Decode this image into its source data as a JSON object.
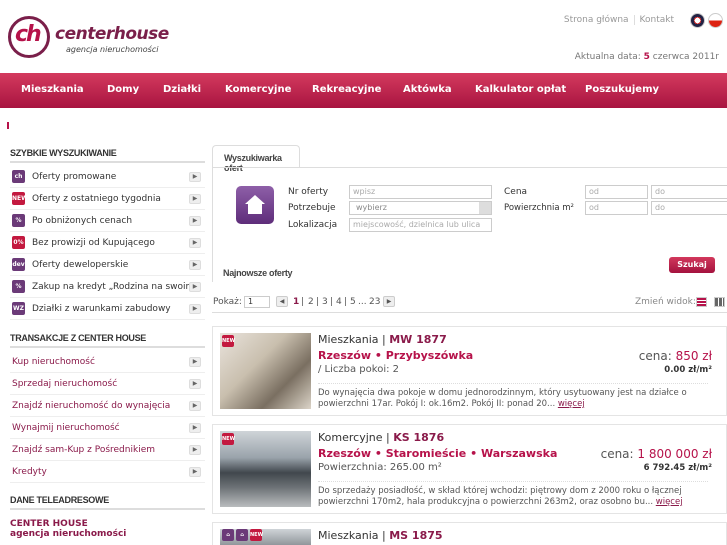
{
  "header": {
    "logo_name": "centerhouse",
    "logo_sub": "agencja nieruchomości",
    "logo_mark": "ch",
    "links": [
      "Strona główna",
      "Kontakt"
    ],
    "date_label": "Aktualna data:",
    "date_day": "5",
    "date_rest": "czerwca 2011r"
  },
  "nav": {
    "items": [
      "Mieszkania",
      "Domy",
      "Działki",
      "Komercyjne",
      "Rekreacyjne",
      "Aktówka",
      "Kalkulator opłat",
      "Poszukujemy"
    ]
  },
  "sidebar": {
    "quick_title": "SZYBKIE WYSZUKIWANIE",
    "quick_items": [
      {
        "label": "Oferty promowane",
        "icon": "ch"
      },
      {
        "label": "Oferty z ostatniego tygodnia",
        "icon": "NEW"
      },
      {
        "label": "Po obniżonych cenach",
        "icon": "%"
      },
      {
        "label": "Bez prowizji od Kupującego",
        "icon": "0%"
      },
      {
        "label": "Oferty deweloperskie",
        "icon": "dev"
      },
      {
        "label": "Zakup na kredyt „Rodzina na swoim”",
        "icon": "%"
      },
      {
        "label": "Działki z warunkami zabudowy",
        "icon": "WZ"
      }
    ],
    "trans_title": "TRANSAKCJE Z CENTER HOUSE",
    "trans_items": [
      "Kup nieruchomość",
      "Sprzedaj nieruchomość",
      "Znajdź nieruchomość do wynajęcia",
      "Wynajmij nieruchomość",
      "Znajdź sam-Kup z Pośrednikiem",
      "Kredyty"
    ],
    "contact_title": "DANE TELEADRESOWE",
    "contact_name": "CENTER HOUSE",
    "contact_sub": "agencja nieruchomości"
  },
  "search": {
    "tab": "Wyszukiwarka ofert",
    "nr_label": "Nr oferty",
    "nr_placeholder": "wpisz",
    "need_label": "Potrzebuje",
    "need_value": "wybierz",
    "loc_label": "Lokalizacja",
    "loc_placeholder": "miejscowość, dzielnica lub ulica",
    "price_label": "Cena",
    "area_label": "Powierzchnia m²",
    "from": "od",
    "to": "do",
    "button": "Szukaj ofert",
    "newest_title": "Najnowsze oferty"
  },
  "pager": {
    "label": "Pokaż:",
    "per_page": "1",
    "pages": [
      "1",
      "|",
      "2",
      "|",
      "3",
      "|",
      "4",
      "|",
      "5",
      "...",
      "23"
    ],
    "view_label": "Zmień widok:"
  },
  "listings": [
    {
      "category": "Mieszkania | ",
      "code": "MW 1877",
      "location": "Rzeszów • Przybyszówka",
      "extra": "/ Liczba pokoi: 2",
      "price_label": "cena: ",
      "price": "850 zł",
      "per_m2": "0.00 zł/m²",
      "desc": "Do wynajęcia dwa pokoje w domu jednorodzinnym, który usytuowany jest na działce o powierzchni 17ar. Pokój I: ok.16m2. Pokój II: ponad 20... ",
      "more": "więcej"
    },
    {
      "category": "Komercyjne | ",
      "code": "KS 1876",
      "location": "Rzeszów • Staromieście • Warszawska",
      "extra": "Powierzchnia: 265.00 m²",
      "price_label": "cena: ",
      "price": "1 800 000 zł",
      "per_m2": "6 792.45 zł/m²",
      "desc": "Do sprzedaży posiadłość, w skład której  wchodzi: piętrowy dom z 2000 roku o łącznej powierzchni 170m2, hala produkcyjna o powierzchni 263m2, oraz osobno bu... ",
      "more": "więcej"
    },
    {
      "category": "Mieszkania | ",
      "code": "MS 1875"
    }
  ]
}
